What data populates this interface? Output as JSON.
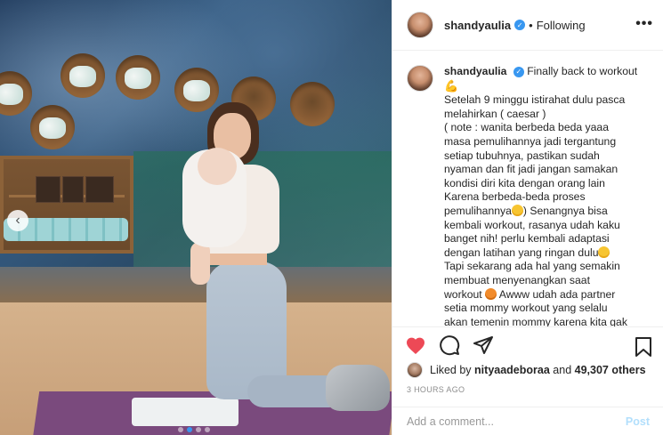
{
  "post": {
    "username": "shandyaulia",
    "follow_separator": "•",
    "follow_status": "Following",
    "more_label": "•••"
  },
  "caption": {
    "username": "shandyaulia",
    "lines": [
      "Finally back to workout",
      "Setelah 9 minggu istirahat dulu pasca",
      "melahirkan ( caesar )",
      "( note : wanita berbeda beda yaaa",
      "masa pemulihannya jadi tergantung",
      "setiap tubuhnya, pastikan sudah",
      "nyaman dan fit jadi jangan samakan",
      "kondisi diri kita dengan orang lain",
      "Karena berbeda-beda proses",
      "pemulihannya",
      ") Senangnya bisa",
      "kembali workout, rasanya udah kaku",
      "banget nih! perlu kembali adaptasi",
      "dengan latihan yang ringan dulu",
      "Tapi sekarang ada hal yang semakin",
      "membuat menyenangkan saat",
      "workout",
      "Awww udah ada partner",
      "setia mommy workout yang selalu",
      "akan temenin mommy karena kita gak"
    ]
  },
  "likes": {
    "prefix": "Liked by",
    "user": "nityaadeboraa",
    "middle": "and",
    "count": "49,307 others"
  },
  "timestamp": "3 HOURS AGO",
  "comment": {
    "placeholder": "Add a comment...",
    "post_label": "Post"
  },
  "icons": {
    "like": "heart-icon",
    "comment": "comment-icon",
    "share": "share-icon",
    "save": "bookmark-icon",
    "prev": "chevron-left-icon",
    "verified": "verified-badge-icon"
  },
  "colors": {
    "like": "#ed4956",
    "verified": "#3897f0",
    "post_button": "#b2dffc",
    "timestamp": "#8e8e8e"
  },
  "carousel": {
    "slide_count": 4,
    "active_slide": 1
  }
}
